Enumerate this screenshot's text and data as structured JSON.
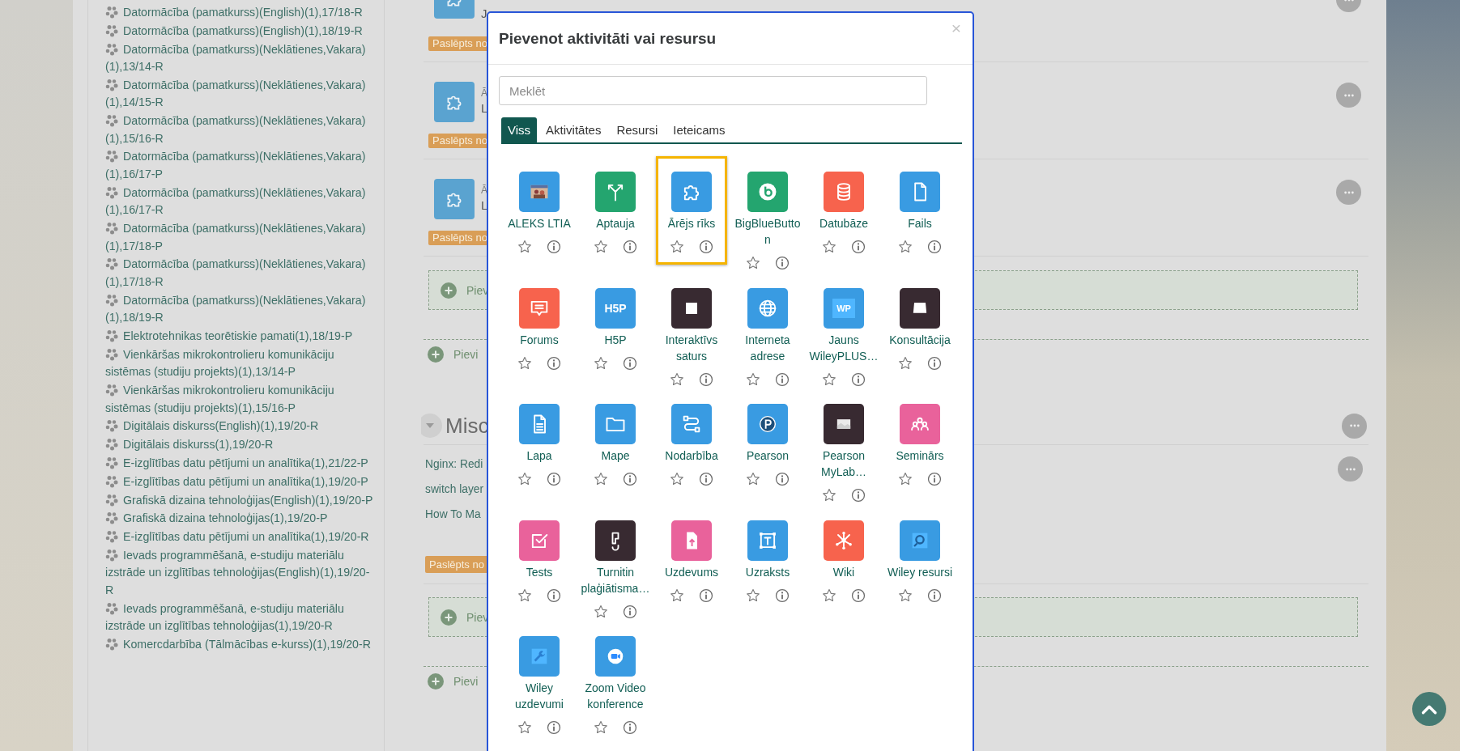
{
  "course_list": [
    "Datormācība (pamatkurss)(English)(1),17/18-R",
    "Datormācība (pamatkurss)(English)(1),18/19-R",
    "Datormācība (pamatkurss)(Neklātienes,Vakara)(1),13/14-R",
    "Datormācība (pamatkurss)(Neklātienes,Vakara)(1),14/15-R",
    "Datormācība (pamatkurss)(Neklātienes,Vakara)(1),15/16-R",
    "Datormācība (pamatkurss)(Neklātienes,Vakara)(1),16/17-P",
    "Datormācība (pamatkurss)(Neklātienes,Vakara)(1),16/17-R",
    "Datormācība (pamatkurss)(Neklātienes,Vakara)(1),17/18-P",
    "Datormācība (pamatkurss)(Neklātienes,Vakara)(1),17/18-R",
    "Datormācība (pamatkurss)(Neklātienes,Vakara)(1),18/19-R",
    "Elektrotehnikas teorētiskie pamati(1),18/19-P",
    "Vienkāršas mikrokontrolieru komunikāciju sistēmas (studiju projekts)(1),13/14-P",
    "Vienkāršas mikrokontrolieru komunikāciju sistēmas (studiju projekts)(1),15/16-P",
    "Digitālais diskurss(English)(1),19/20-R",
    "Digitālais diskurss(1),19/20-R",
    "E-izglītības datu pētījumi un analītika(1),21/22-P",
    "E-izglītības datu pētījumi un analītika(1),19/20-P",
    "Grafiskā dizaina tehnoloģijas(English)(1),19/20-P",
    "Grafiskā dizaina tehnoloģijas(1),19/20-P",
    "E-izglītības datu pētījumi un analītika(1),19/20-R",
    "Ievads programmēšanā, e-studiju materiālu izstrāde un izglītības tehnoloģijas(English)(1),19/20-R",
    "Ievads programmēšanā, e-studiju materiālu izstrāde un izglītības tehnoloģijas(1),19/20-R",
    "Komercdarbība (Tālmācības e-kurss)(1),19/20-R"
  ],
  "section_items": [
    {
      "kind": "activity",
      "description": "J",
      "badge": "Paslēpts no"
    },
    {
      "kind": "activity",
      "title": "Ā",
      "description": "L",
      "badge": "Paslēpts no"
    },
    {
      "kind": "activity",
      "title": "Ā",
      "description": "L",
      "badge": "Paslēpts no"
    },
    {
      "kind": "add_box",
      "label": "Piev"
    },
    {
      "kind": "add_link",
      "label": "Pievi"
    },
    {
      "kind": "section_header",
      "title": "Misc"
    },
    {
      "kind": "label",
      "lines": [
        "Nginx: Redi",
        "switch layer",
        "How To Ma"
      ],
      "badge": "Paslēpts no"
    },
    {
      "kind": "add_box",
      "label": "Piev"
    },
    {
      "kind": "add_link",
      "label": "Pievi"
    }
  ],
  "dialog": {
    "title": "Pievenot aktivitāti vai resursu",
    "close": "×",
    "search": {
      "placeholder": "Meklēt"
    },
    "tabs": [
      {
        "label": "Viss",
        "selected": true
      },
      {
        "label": "Aktivitātes",
        "selected": false
      },
      {
        "label": "Resursi",
        "selected": false
      },
      {
        "label": "Ieteicams",
        "selected": false
      }
    ],
    "items": [
      {
        "name": "ALEKS LTIA",
        "color": "#399be2",
        "selected": false,
        "starred": false
      },
      {
        "name": "Aptauja",
        "color": "#24a56f",
        "selected": false,
        "starred": false
      },
      {
        "name": "Ārējs rīks",
        "color": "#399be2",
        "selected": true,
        "starred": false
      },
      {
        "name": "BigBlueButton",
        "color": "#24a56f",
        "selected": false,
        "starred": false
      },
      {
        "name": "Datubāze",
        "color": "#f7634d",
        "selected": false,
        "starred": false
      },
      {
        "name": "Fails",
        "color": "#399be2",
        "selected": false,
        "starred": false
      },
      {
        "name": "Forums",
        "color": "#f7634d",
        "selected": false,
        "starred": false
      },
      {
        "name": "H5P",
        "color": "#399be2",
        "selected": false,
        "starred": false,
        "icon_text": "H5P"
      },
      {
        "name": "Interaktīvs saturs",
        "color": "#382a31",
        "selected": false,
        "starred": false
      },
      {
        "name": "Interneta adrese",
        "color": "#399be2",
        "selected": false,
        "starred": false
      },
      {
        "name": "Jauns WileyPLUS…",
        "color": "#399be2",
        "selected": false,
        "starred": false,
        "icon_text": "WP"
      },
      {
        "name": "Konsultācija",
        "color": "#382a31",
        "selected": false,
        "starred": false
      },
      {
        "name": "Lapa",
        "color": "#399be2",
        "selected": false,
        "starred": false
      },
      {
        "name": "Mape",
        "color": "#399be2",
        "selected": false,
        "starred": false
      },
      {
        "name": "Nodarbība",
        "color": "#399be2",
        "selected": false,
        "starred": false
      },
      {
        "name": "Pearson",
        "color": "#399be2",
        "selected": false,
        "starred": false
      },
      {
        "name": "Pearson MyLab…",
        "color": "#382a31",
        "selected": false,
        "starred": false
      },
      {
        "name": "Seminārs",
        "color": "#e9629b",
        "selected": false,
        "starred": false
      },
      {
        "name": "Tests",
        "color": "#e9629b",
        "selected": false,
        "starred": false
      },
      {
        "name": "Turnitin plaģiātisma…",
        "color": "#382a31",
        "selected": false,
        "starred": false
      },
      {
        "name": "Uzdevums",
        "color": "#e9629b",
        "selected": false,
        "starred": false
      },
      {
        "name": "Uzraksts",
        "color": "#399be2",
        "selected": false,
        "starred": false
      },
      {
        "name": "Wiki",
        "color": "#f7634d",
        "selected": false,
        "starred": false
      },
      {
        "name": "Wiley resursi",
        "color": "#399be2",
        "selected": false,
        "starred": false
      },
      {
        "name": "Wiley uzdevumi",
        "color": "#399be2",
        "selected": false,
        "starred": false
      },
      {
        "name": "Zoom Video konference",
        "color": "#399be2",
        "selected": false,
        "starred": false
      }
    ]
  }
}
